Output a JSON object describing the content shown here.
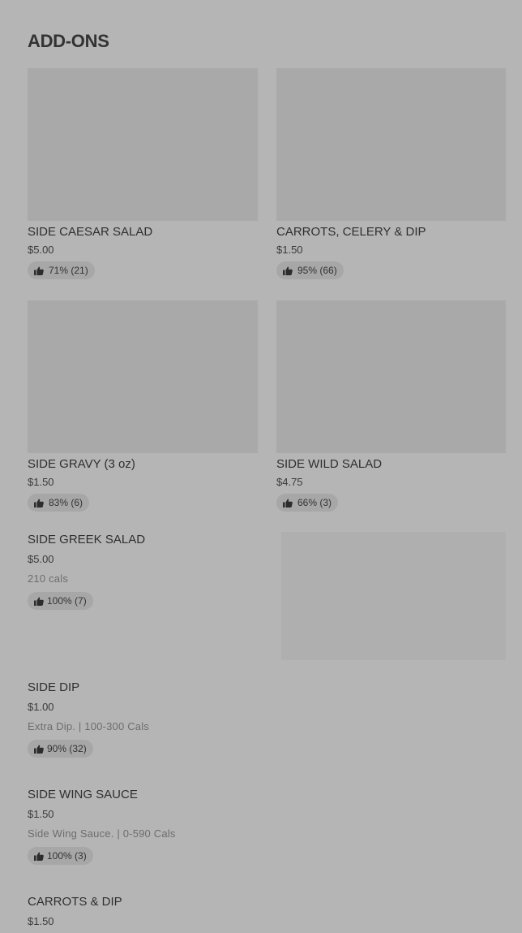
{
  "section": {
    "title": "ADD-ONS"
  },
  "grid_items": [
    {
      "name": "SIDE CAESAR SALAD",
      "price": "$5.00",
      "rating": "71% (21)"
    },
    {
      "name": "CARROTS, CELERY & DIP",
      "price": "$1.50",
      "rating": "95% (66)"
    },
    {
      "name": "SIDE GRAVY (3 oz)",
      "price": "$1.50",
      "rating": "83% (6)"
    },
    {
      "name": "SIDE WILD SALAD",
      "price": "$4.75",
      "rating": "66% (3)"
    }
  ],
  "list_items": [
    {
      "name": "SIDE GREEK SALAD",
      "price": "$5.00",
      "desc": "210 cals",
      "rating": "100% (7)"
    },
    {
      "name": "SIDE DIP",
      "price": "$1.00",
      "desc": "Extra Dip. | 100-300 Cals",
      "rating": "90% (32)"
    },
    {
      "name": "SIDE WING SAUCE",
      "price": "$1.50",
      "desc": "Side Wing Sauce. | 0-590 Cals",
      "rating": "100% (3)"
    },
    {
      "name": "CARROTS & DIP",
      "price": "$1.50"
    }
  ]
}
